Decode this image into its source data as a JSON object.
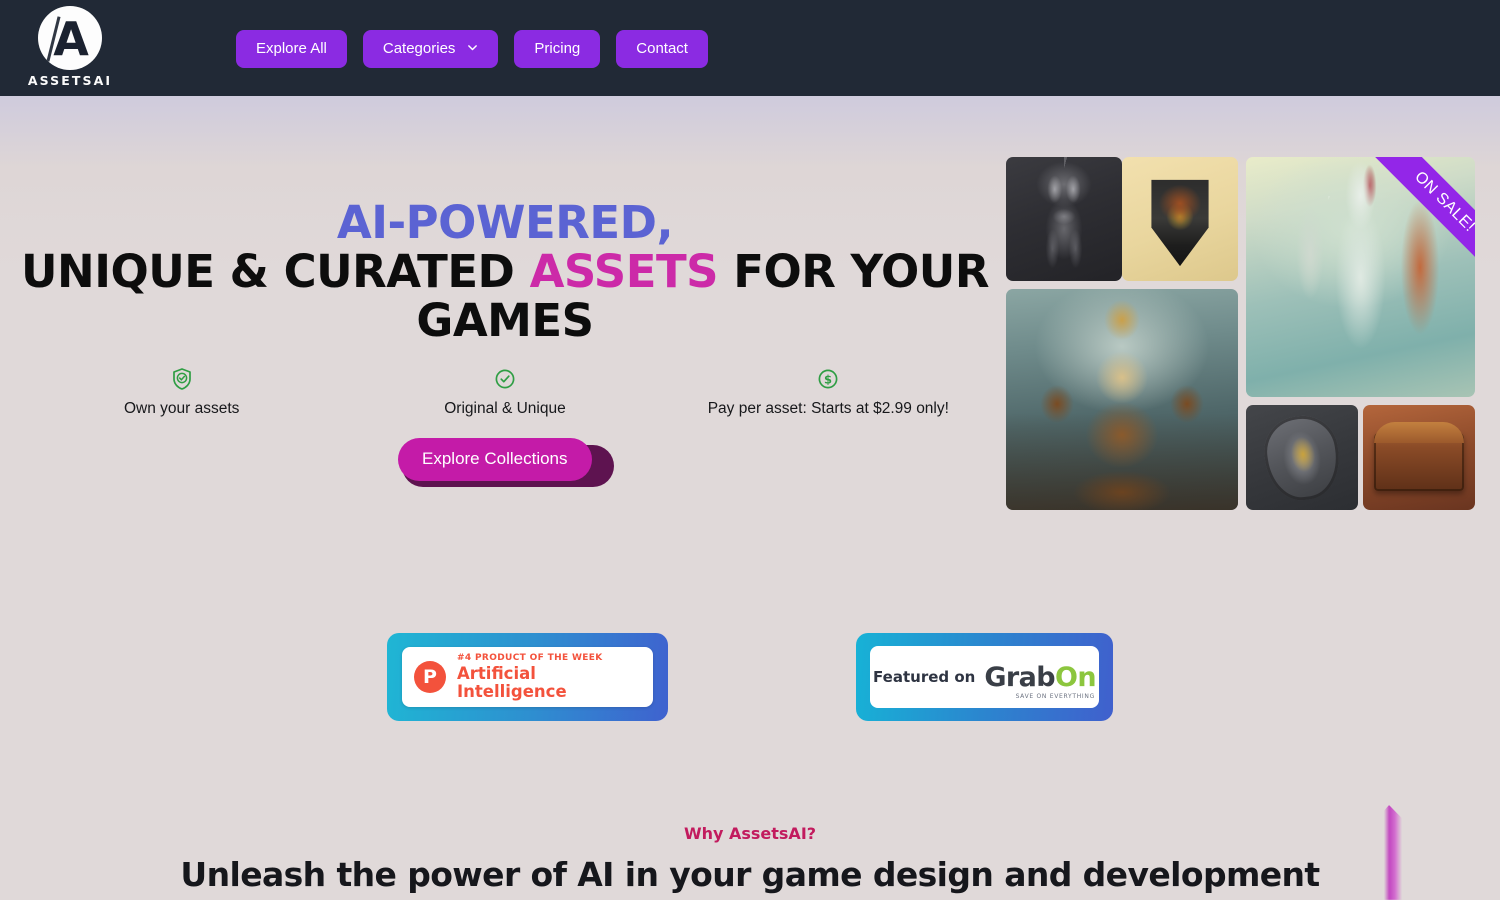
{
  "brand": {
    "name": "ASSETSAI",
    "logo_letter": "A",
    "logo_icon": "assetsai-logo"
  },
  "nav": {
    "items": [
      {
        "label": "Explore All",
        "icon": null
      },
      {
        "label": "Categories",
        "icon": "chevron-down-icon"
      },
      {
        "label": "Pricing",
        "icon": null
      },
      {
        "label": "Contact",
        "icon": null
      }
    ]
  },
  "hero": {
    "headline": {
      "line1": "AI-POWERED,",
      "line2_a": "UNIQUE & CURATED ",
      "line2_highlight": "ASSETS",
      "line2_b": " FOR YOUR",
      "line3": "GAMES"
    },
    "features": [
      {
        "icon": "shield-check-icon",
        "label": "Own your assets"
      },
      {
        "icon": "circle-check-icon",
        "label": "Original & Unique"
      },
      {
        "icon": "dollar-circle-icon",
        "label": "Pay per asset: Starts at $2.99 only!"
      }
    ],
    "cta_label": "Explore Collections",
    "ribbon_label": "ON SALE!",
    "collage": [
      {
        "name": "knight-armor",
        "alt": "Dark knight armor asset"
      },
      {
        "name": "heraldic-crest",
        "alt": "Heraldic shield crest asset"
      },
      {
        "name": "golem-boss",
        "alt": "Ornate golem boss character asset"
      },
      {
        "name": "jade-mage",
        "alt": "Jade robed mage character asset"
      },
      {
        "name": "round-shield",
        "alt": "Battle shield asset"
      },
      {
        "name": "treasure-chest",
        "alt": "Wooden treasure chest asset"
      }
    ]
  },
  "badges": {
    "product_hunt": {
      "rank_text": "#4 PRODUCT OF THE WEEK",
      "category": "Artificial Intelligence",
      "mark": "P"
    },
    "grabon": {
      "prefix": "Featured on",
      "logo_part1": "Grab",
      "logo_part2": "On",
      "tagline": "SAVE ON EVERYTHING"
    }
  },
  "why": {
    "eyebrow": "Why AssetsAI?",
    "title": "Unleash the power of AI in your game design and development"
  },
  "colors": {
    "header_bg": "#212936",
    "nav_button": "#8b2be2",
    "headline_blue": "#5b63d3",
    "headline_pink": "#cc2aa8",
    "cta": "#c41ba8",
    "feature_icon_green": "#2f9e44",
    "ribbon_purple": "#9326e8",
    "why_eyebrow": "#c21b5e",
    "page_bg": "#e0d9d9"
  }
}
